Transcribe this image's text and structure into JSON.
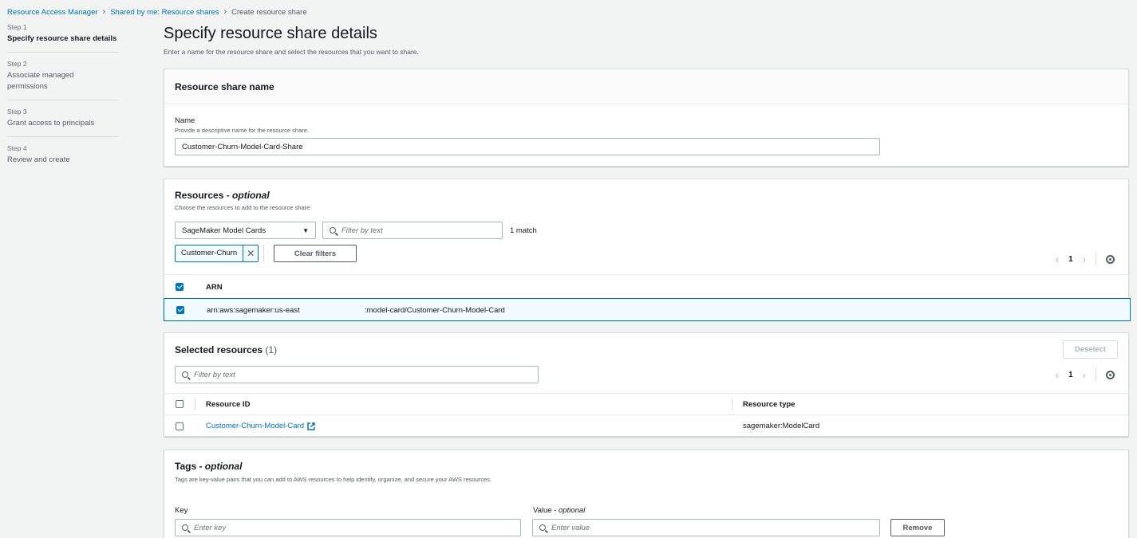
{
  "breadcrumb": {
    "items": [
      "Resource Access Manager",
      "Shared by me: Resource shares"
    ],
    "current": "Create resource share"
  },
  "steps": [
    {
      "num": "Step 1",
      "label": "Specify resource share details"
    },
    {
      "num": "Step 2",
      "label": "Associate managed permissions"
    },
    {
      "num": "Step 3",
      "label": "Grant access to principals"
    },
    {
      "num": "Step 4",
      "label": "Review and create"
    }
  ],
  "page": {
    "title": "Specify resource share details",
    "description": "Enter a name for the resource share and select the resources that you want to share."
  },
  "name_panel": {
    "title": "Resource share name",
    "field_label": "Name",
    "field_desc": "Provide a descriptive name for the resource share.",
    "value": "Customer-Churn-Model-Card-Share"
  },
  "resources_panel": {
    "title": "Resources - ",
    "title_optional": "optional",
    "desc": "Choose the resources to add to the resource share",
    "select_value": "SageMaker Model Cards",
    "filter_placeholder": "Filter by text",
    "match_count": "1 match",
    "token": "Customer-Churn",
    "clear_filters": "Clear filters",
    "page": "1",
    "col_arn": "ARN",
    "row_arn_left": "arn:aws:sagemaker:us-east",
    "row_arn_right": ":model-card/Customer-Churn-Model-Card"
  },
  "selected_panel": {
    "title": "Selected resources",
    "count": "(1)",
    "deselect": "Deselect",
    "filter_placeholder": "Filter by text",
    "page": "1",
    "col_id": "Resource ID",
    "col_type": "Resource type",
    "row_id": "Customer-Churn-Model-Card",
    "row_type": "sagemaker:ModelCard"
  },
  "tags_panel": {
    "title": "Tags - ",
    "title_optional": "optional",
    "desc": "Tags are key-value pairs that you can add to AWS resources to help identify, organize, and secure your AWS resources.",
    "key_label": "Key",
    "value_label": "Value - ",
    "value_optional": "optional",
    "key_placeholder": "Enter key",
    "value_placeholder": "Enter value",
    "remove": "Remove"
  },
  "colors": {
    "accent": "#0073bb",
    "text": "#16191f",
    "muted": "#545b64",
    "bg": "#f2f3f3"
  }
}
